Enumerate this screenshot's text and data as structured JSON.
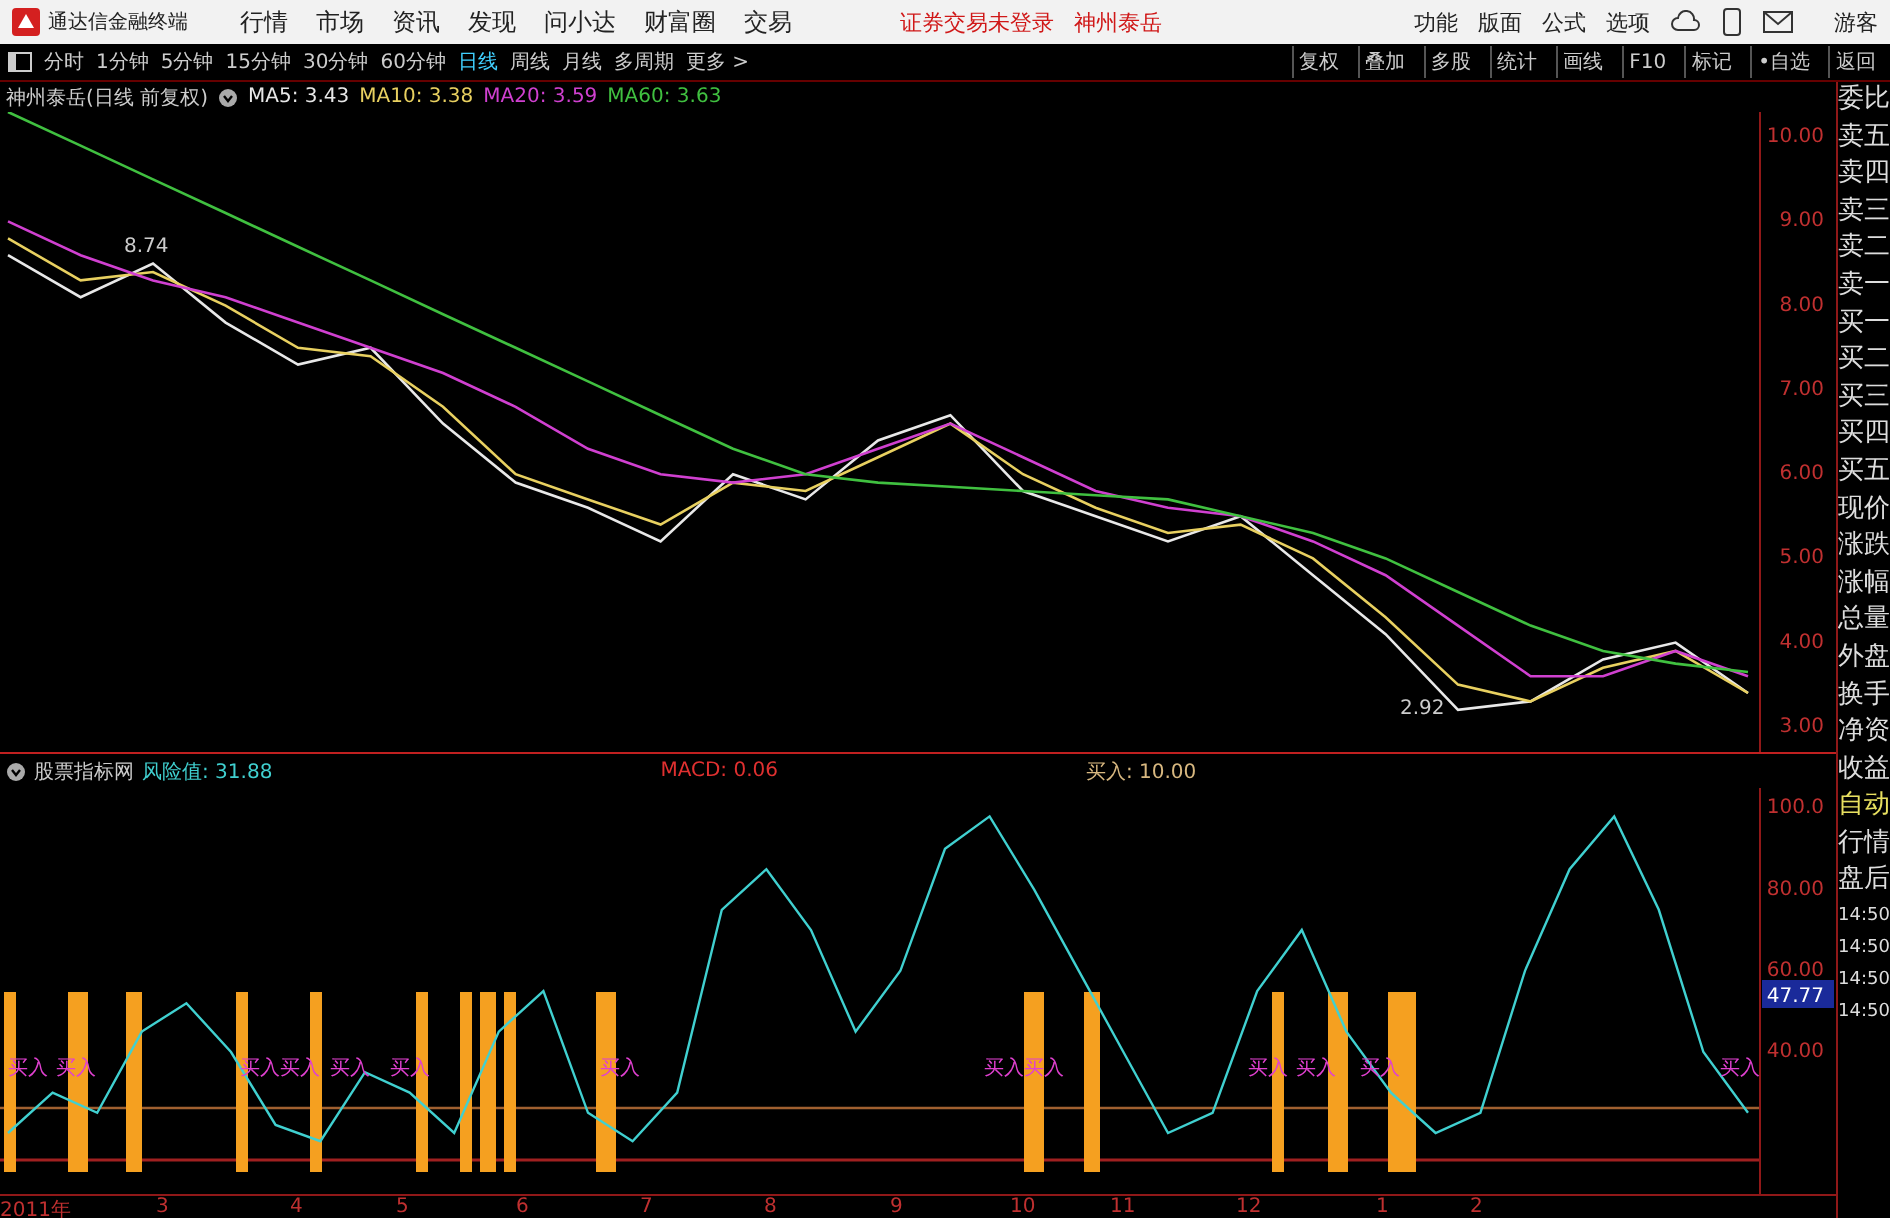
{
  "app": {
    "title": "通达信金融终端",
    "menu": [
      "行情",
      "市场",
      "资讯",
      "发现",
      "问小达",
      "财富圈",
      "交易"
    ],
    "notice": "证券交易未登录",
    "stock_link": "神州泰岳",
    "right_menu": [
      "功能",
      "版面",
      "公式",
      "选项"
    ],
    "user": "游客"
  },
  "periods": [
    {
      "label": "分时",
      "selected": false
    },
    {
      "label": "1分钟",
      "selected": false
    },
    {
      "label": "5分钟",
      "selected": false
    },
    {
      "label": "15分钟",
      "selected": false
    },
    {
      "label": "30分钟",
      "selected": false
    },
    {
      "label": "60分钟",
      "selected": false
    },
    {
      "label": "日线",
      "selected": true
    },
    {
      "label": "周线",
      "selected": false
    },
    {
      "label": "月线",
      "selected": false
    },
    {
      "label": "多周期",
      "selected": false
    },
    {
      "label": "更多 >",
      "selected": false
    }
  ],
  "toolbar_buttons": [
    "复权",
    "叠加",
    "多股",
    "统计",
    "画线",
    "F10",
    "标记",
    "•自选",
    "返回"
  ],
  "price_chart": {
    "title": "神州泰岳(日线 前复权)",
    "legend_values": [
      ": 3.43",
      ": 3.38",
      ": 3.59",
      ": 3.63"
    ],
    "chart_data": {
      "type": "line",
      "ylim": [
        2.7,
        10.3
      ],
      "yticks": [
        {
          "value": 10,
          "label": "10.00"
        },
        {
          "value": 9,
          "label": "9.00"
        },
        {
          "value": 8,
          "label": "8.00"
        },
        {
          "value": 7,
          "label": "7.00"
        },
        {
          "value": 6,
          "label": "6.00"
        },
        {
          "value": 5,
          "label": "5.00"
        },
        {
          "value": 4,
          "label": "4.00"
        },
        {
          "value": 3,
          "label": "3.00"
        }
      ],
      "series": [
        {
          "name": "MA5",
          "color": "#e8e8e8",
          "values": [
            8.6,
            8.1,
            8.5,
            7.8,
            7.3,
            7.5,
            6.6,
            5.9,
            5.6,
            5.2,
            6.0,
            5.7,
            6.4,
            6.7,
            5.8,
            5.5,
            5.2,
            5.5,
            4.8,
            4.1,
            3.2,
            3.3,
            3.8,
            4.0,
            3.4
          ]
        },
        {
          "name": "MA10",
          "color": "#e8d060",
          "values": [
            8.8,
            8.3,
            8.4,
            8.0,
            7.5,
            7.4,
            6.8,
            6.0,
            5.7,
            5.4,
            5.9,
            5.8,
            6.2,
            6.6,
            6.0,
            5.6,
            5.3,
            5.4,
            5.0,
            4.3,
            3.5,
            3.3,
            3.7,
            3.9,
            3.4
          ]
        },
        {
          "name": "MA20",
          "color": "#d040d0",
          "values": [
            9.0,
            8.6,
            8.3,
            8.1,
            7.8,
            7.5,
            7.2,
            6.8,
            6.3,
            6.0,
            5.9,
            6.0,
            6.3,
            6.6,
            6.2,
            5.8,
            5.6,
            5.5,
            5.2,
            4.8,
            4.2,
            3.6,
            3.6,
            3.9,
            3.6
          ]
        },
        {
          "name": "MA60",
          "color": "#40c040",
          "values": [
            10.3,
            9.9,
            9.5,
            9.1,
            8.7,
            8.3,
            7.9,
            7.5,
            7.1,
            6.7,
            6.3,
            6.0,
            5.9,
            5.85,
            5.8,
            5.75,
            5.7,
            5.5,
            5.3,
            5.0,
            4.6,
            4.2,
            3.9,
            3.75,
            3.65
          ]
        }
      ]
    },
    "price_marks": [
      "8.74",
      "2.92"
    ]
  },
  "indicator": {
    "source": "股票指标网",
    "risk_value": ": 31.88",
    "readings": [
      {
        "label": "MACD: 0.06",
        "color": "#e03030"
      },
      {
        "label": "买入: 10.00",
        "color": "#d8b880"
      }
    ],
    "chart_data": {
      "type": "line",
      "ylim": [
        5,
        105
      ],
      "yticks": [
        {
          "value": 100,
          "label": "100.0"
        },
        {
          "value": 80,
          "label": "80.00"
        },
        {
          "value": 60,
          "label": "60.00"
        },
        {
          "value": 40,
          "label": "40.00"
        }
      ],
      "series": [
        {
          "name": "风险值",
          "color": "#40d0d0",
          "values": [
            20,
            30,
            25,
            45,
            52,
            40,
            22,
            18,
            35,
            30,
            20,
            45,
            55,
            25,
            18,
            30,
            75,
            85,
            70,
            45,
            60,
            90,
            98,
            80,
            60,
            40,
            20,
            25,
            55,
            70,
            45,
            30,
            20,
            25,
            60,
            85,
            98,
            75,
            40,
            25
          ]
        }
      ]
    },
    "value_tag": "47.77",
    "buy_labels": [
      "买入",
      "买入",
      "买入",
      "买入",
      "买入",
      "买入",
      "买入",
      "买入",
      "买入",
      "买入",
      "买入",
      "买入",
      "买入"
    ]
  },
  "date_axis": [
    "2011年",
    "3",
    "4",
    "5",
    "6",
    "7",
    "8",
    "9",
    "10",
    "11",
    "12",
    "1",
    "2"
  ],
  "quote_panel": {
    "labels": [
      "委比",
      "卖五",
      "卖四",
      "卖三",
      "卖二",
      "卖一",
      "买一",
      "买二",
      "买三",
      "买四",
      "买五",
      "现价",
      "涨跌",
      "涨幅",
      "总量",
      "外盘",
      "换手",
      "净资",
      "收益"
    ],
    "mode_labels": [
      "自动",
      "行情",
      "盘后"
    ],
    "times": [
      "14:50",
      "14:50",
      "14:50",
      "14:50"
    ]
  }
}
